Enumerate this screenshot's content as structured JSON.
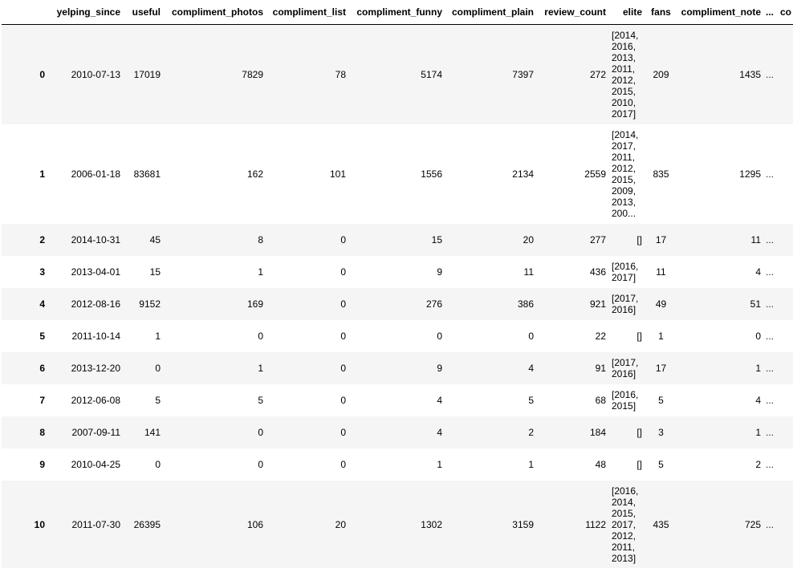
{
  "table": {
    "columns": [
      "yelping_since",
      "useful",
      "compliment_photos",
      "compliment_list",
      "compliment_funny",
      "compliment_plain",
      "review_count",
      "elite",
      "fans",
      "compliment_note",
      "...",
      "co"
    ],
    "rows": [
      {
        "index": "0",
        "yelping_since": "2010-07-13",
        "useful": "17019",
        "compliment_photos": "7829",
        "compliment_list": "78",
        "compliment_funny": "5174",
        "compliment_plain": "7397",
        "review_count": "272",
        "elite": [
          "[2014,",
          "2016,",
          "2013,",
          "2011,",
          "2012,",
          "2015,",
          "2010,",
          "2017]"
        ],
        "fans": "209",
        "compliment_note": "1435",
        "more": "..."
      },
      {
        "index": "1",
        "yelping_since": "2006-01-18",
        "useful": "83681",
        "compliment_photos": "162",
        "compliment_list": "101",
        "compliment_funny": "1556",
        "compliment_plain": "2134",
        "review_count": "2559",
        "elite": [
          "[2014,",
          "2017,",
          "2011,",
          "2012,",
          "2015,",
          "2009,",
          "2013,",
          "200..."
        ],
        "fans": "835",
        "compliment_note": "1295",
        "more": "..."
      },
      {
        "index": "2",
        "yelping_since": "2014-10-31",
        "useful": "45",
        "compliment_photos": "8",
        "compliment_list": "0",
        "compliment_funny": "15",
        "compliment_plain": "20",
        "review_count": "277",
        "elite": [
          "[]"
        ],
        "fans": "17",
        "compliment_note": "11",
        "more": "..."
      },
      {
        "index": "3",
        "yelping_since": "2013-04-01",
        "useful": "15",
        "compliment_photos": "1",
        "compliment_list": "0",
        "compliment_funny": "9",
        "compliment_plain": "11",
        "review_count": "436",
        "elite": [
          "[2016,",
          "2017]"
        ],
        "fans": "11",
        "compliment_note": "4",
        "more": "..."
      },
      {
        "index": "4",
        "yelping_since": "2012-08-16",
        "useful": "9152",
        "compliment_photos": "169",
        "compliment_list": "0",
        "compliment_funny": "276",
        "compliment_plain": "386",
        "review_count": "921",
        "elite": [
          "[2017,",
          "2016]"
        ],
        "fans": "49",
        "compliment_note": "51",
        "more": "..."
      },
      {
        "index": "5",
        "yelping_since": "2011-10-14",
        "useful": "1",
        "compliment_photos": "0",
        "compliment_list": "0",
        "compliment_funny": "0",
        "compliment_plain": "0",
        "review_count": "22",
        "elite": [
          "[]"
        ],
        "fans": "1",
        "compliment_note": "0",
        "more": "..."
      },
      {
        "index": "6",
        "yelping_since": "2013-12-20",
        "useful": "0",
        "compliment_photos": "1",
        "compliment_list": "0",
        "compliment_funny": "9",
        "compliment_plain": "4",
        "review_count": "91",
        "elite": [
          "[2017,",
          "2016]"
        ],
        "fans": "17",
        "compliment_note": "1",
        "more": "..."
      },
      {
        "index": "7",
        "yelping_since": "2012-06-08",
        "useful": "5",
        "compliment_photos": "5",
        "compliment_list": "0",
        "compliment_funny": "4",
        "compliment_plain": "5",
        "review_count": "68",
        "elite": [
          "[2016,",
          "2015]"
        ],
        "fans": "5",
        "compliment_note": "4",
        "more": "..."
      },
      {
        "index": "8",
        "yelping_since": "2007-09-11",
        "useful": "141",
        "compliment_photos": "0",
        "compliment_list": "0",
        "compliment_funny": "4",
        "compliment_plain": "2",
        "review_count": "184",
        "elite": [
          "[]"
        ],
        "fans": "3",
        "compliment_note": "1",
        "more": "..."
      },
      {
        "index": "9",
        "yelping_since": "2010-04-25",
        "useful": "0",
        "compliment_photos": "0",
        "compliment_list": "0",
        "compliment_funny": "1",
        "compliment_plain": "1",
        "review_count": "48",
        "elite": [
          "[]"
        ],
        "fans": "5",
        "compliment_note": "2",
        "more": "..."
      },
      {
        "index": "10",
        "yelping_since": "2011-07-30",
        "useful": "26395",
        "compliment_photos": "106",
        "compliment_list": "20",
        "compliment_funny": "1302",
        "compliment_plain": "3159",
        "review_count": "1122",
        "elite": [
          "[2016,",
          "2014,",
          "2015,",
          "2017,",
          "2012,",
          "2011,",
          "2013]"
        ],
        "fans": "435",
        "compliment_note": "725",
        "more": "..."
      }
    ]
  }
}
